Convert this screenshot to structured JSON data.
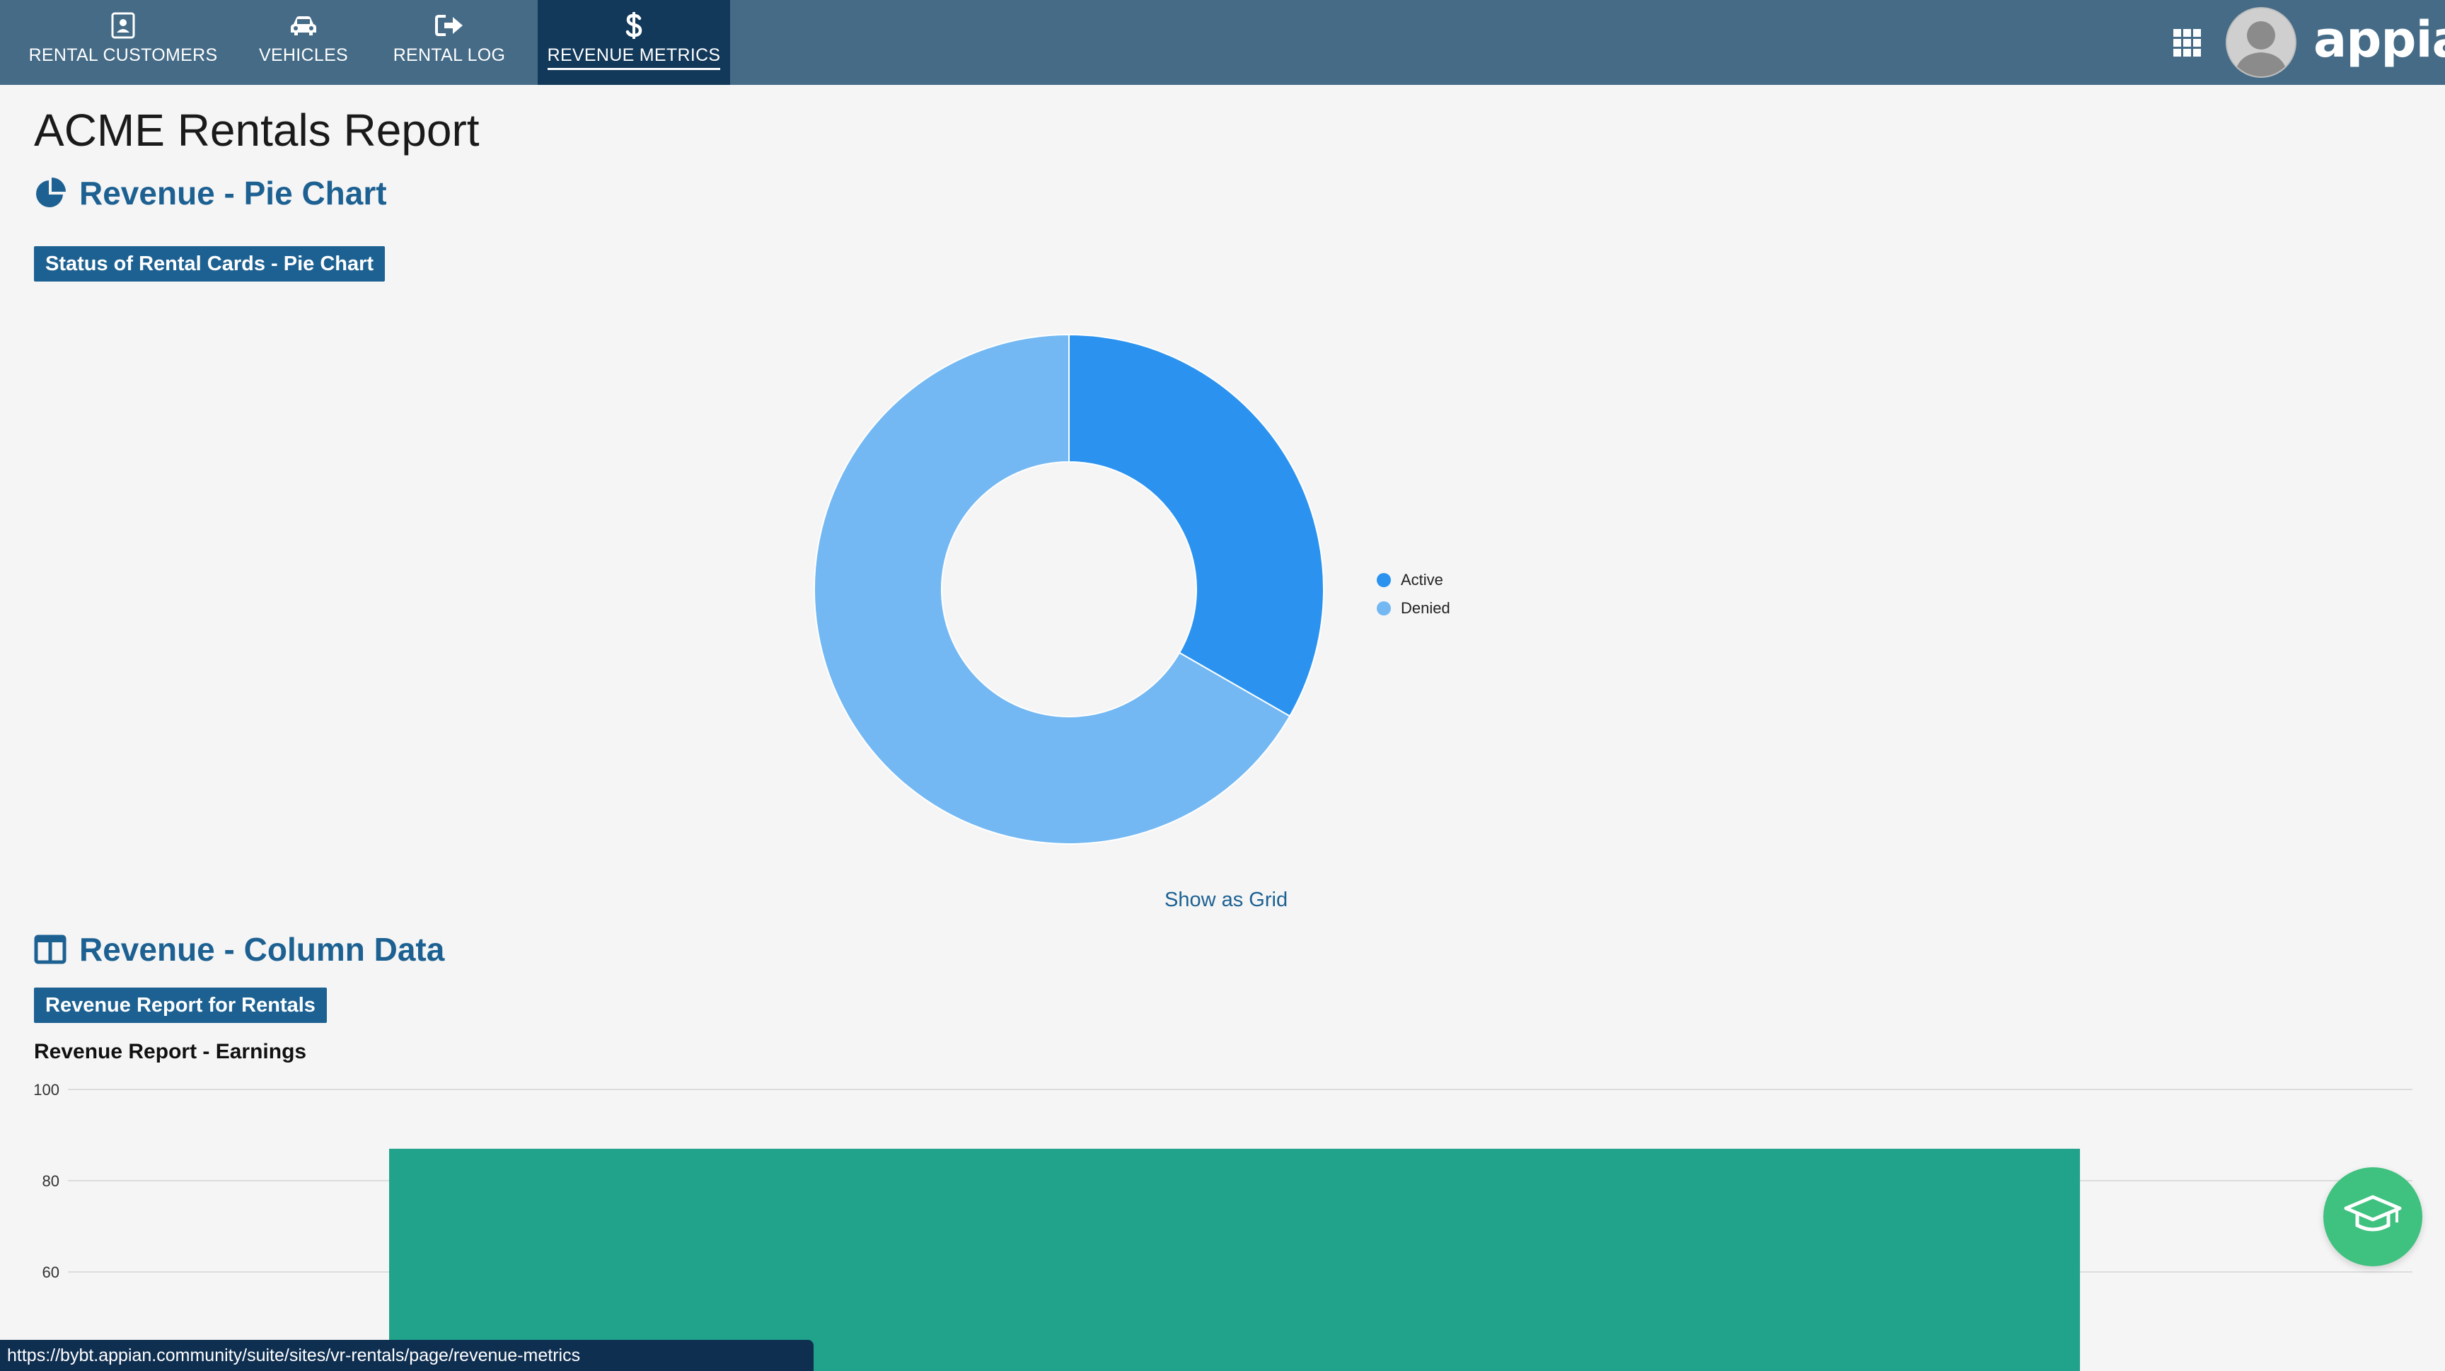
{
  "nav": {
    "tabs": [
      {
        "label": "RENTAL CUSTOMERS",
        "icon": "contact-card-icon"
      },
      {
        "label": "VEHICLES",
        "icon": "car-icon"
      },
      {
        "label": "RENTAL LOG",
        "icon": "sign-out-icon"
      },
      {
        "label": "REVENUE METRICS",
        "icon": "dollar-icon",
        "active": true
      }
    ],
    "logo": "appian"
  },
  "page": {
    "title": "ACME Rentals Report"
  },
  "pie_section": {
    "heading": "Revenue - Pie Chart",
    "tag": "Status of Rental Cards - Pie Chart",
    "show_grid": "Show as Grid"
  },
  "column_section": {
    "heading": "Revenue - Column Data",
    "tag": "Revenue Report for Rentals"
  },
  "status_bar": {
    "url": "https://bybt.appian.community/suite/sites/vr-rentals/page/revenue-metrics"
  },
  "colors": {
    "nav": "#456b87",
    "nav_active": "#12395a",
    "heading": "#1d6192",
    "active_slice": "#2b93ef",
    "denied_slice": "#73b8f3",
    "bar": "#21a28b",
    "help": "#3fc17f"
  },
  "chart_data": [
    {
      "type": "pie",
      "donut": true,
      "title": "",
      "labels": [
        "Active",
        "Denied"
      ],
      "values": [
        33.3,
        66.7
      ],
      "colors": [
        "#2b93ef",
        "#73b8f3"
      ],
      "legend": "right"
    },
    {
      "type": "bar",
      "title": "Revenue Report - Earnings",
      "categories": [
        ""
      ],
      "series": [
        {
          "values": [
            87
          ]
        }
      ],
      "ylim": [
        0,
        100
      ],
      "yticks": [
        60,
        80,
        100
      ],
      "colors": [
        "#21a28b"
      ],
      "grid": true
    }
  ]
}
